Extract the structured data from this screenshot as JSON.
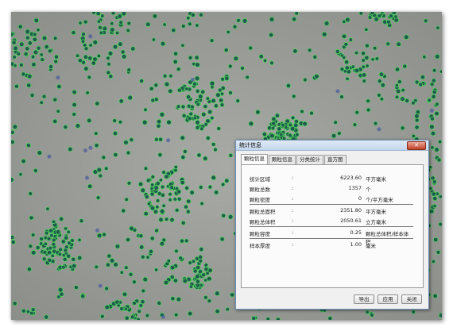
{
  "dialog": {
    "title": "统计信息",
    "close_label": "✕",
    "tabs": [
      {
        "label": "颗粒信息",
        "active": true
      },
      {
        "label": "颗粒信息",
        "active": false
      },
      {
        "label": "分类统计",
        "active": false
      },
      {
        "label": "直方图",
        "active": false
      }
    ],
    "stats": [
      {
        "label": "统计区域",
        "colon": ":",
        "value": "6223.60",
        "unit": "平方毫米"
      },
      {
        "label": "颗粒总数",
        "colon": ":",
        "value": "1357",
        "unit": "个"
      },
      {
        "label": "颗粒密度",
        "colon": ":",
        "value": "0",
        "unit": "个/平方毫米"
      },
      {
        "label": "颗粒总面积",
        "colon": ":",
        "value": "2351.80",
        "unit": "平方毫米"
      },
      {
        "label": "颗粒总体积",
        "colon": ":",
        "value": "2050.61",
        "unit": "立方毫米"
      },
      {
        "label": "颗粒容度",
        "colon": ":",
        "value": "0.25",
        "unit": "颗粒总体积/样本体积"
      },
      {
        "label": "样本厚度",
        "colon": ":",
        "value": "1.00",
        "unit": "毫米"
      }
    ],
    "buttons": {
      "export": "导出",
      "apply": "应用",
      "close": "关闭"
    }
  },
  "colors": {
    "background": "#9a9c98",
    "particle_fill": "#1f5c4e",
    "particle_outline": "#4fd35a",
    "titlebar": "#c4d6ec"
  }
}
